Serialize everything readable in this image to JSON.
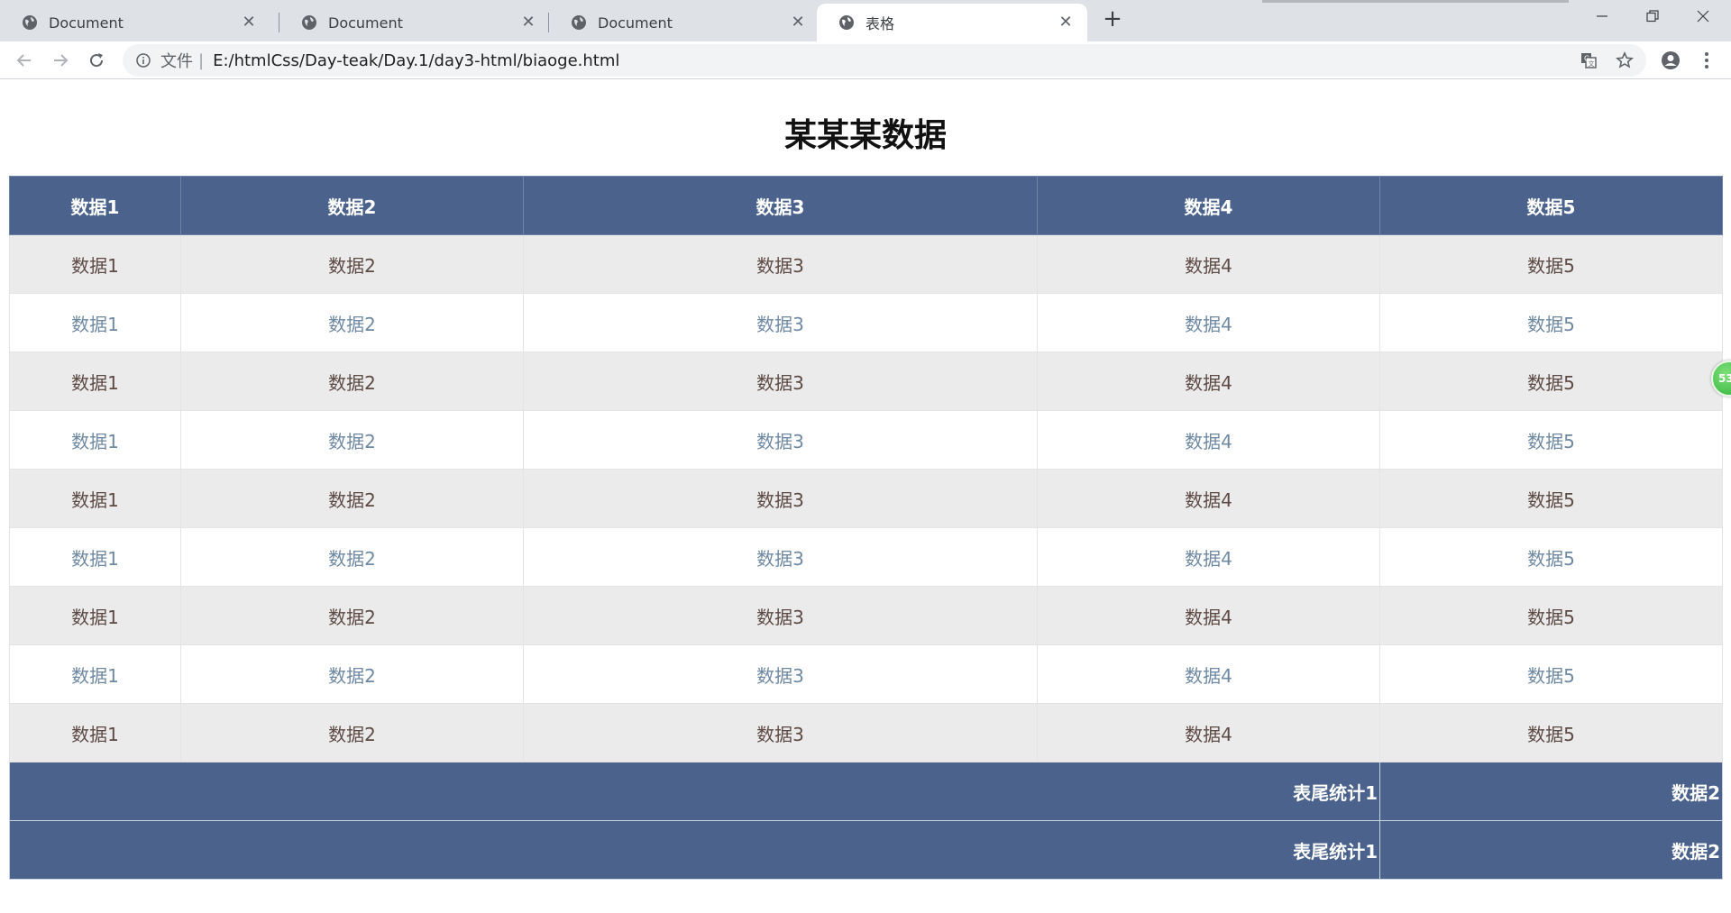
{
  "browser": {
    "tabs": [
      {
        "title": "Document",
        "active": false
      },
      {
        "title": "Document",
        "active": false
      },
      {
        "title": "Document",
        "active": false
      },
      {
        "title": "表格",
        "active": true
      }
    ],
    "new_tab_label": "+",
    "address": {
      "scheme_label": "文件",
      "separator": "|",
      "url": "E:/htmlCss/Day-teak/Day.1/day3-html/biaoge.html"
    }
  },
  "page": {
    "title": "某某某数据",
    "table": {
      "headers": [
        "数据1",
        "数据2",
        "数据3",
        "数据4",
        "数据5"
      ],
      "rows": [
        [
          "数据1",
          "数据2",
          "数据3",
          "数据4",
          "数据5"
        ],
        [
          "数据1",
          "数据2",
          "数据3",
          "数据4",
          "数据5"
        ],
        [
          "数据1",
          "数据2",
          "数据3",
          "数据4",
          "数据5"
        ],
        [
          "数据1",
          "数据2",
          "数据3",
          "数据4",
          "数据5"
        ],
        [
          "数据1",
          "数据2",
          "数据3",
          "数据4",
          "数据5"
        ],
        [
          "数据1",
          "数据2",
          "数据3",
          "数据4",
          "数据5"
        ],
        [
          "数据1",
          "数据2",
          "数据3",
          "数据4",
          "数据5"
        ],
        [
          "数据1",
          "数据2",
          "数据3",
          "数据4",
          "数据5"
        ],
        [
          "数据1",
          "数据2",
          "数据3",
          "数据4",
          "数据5"
        ]
      ],
      "footer": [
        {
          "label": "表尾统计1",
          "value": "数据2"
        },
        {
          "label": "表尾统计1",
          "value": "数据2"
        }
      ]
    }
  },
  "float_widget": {
    "label": "53"
  },
  "colors": {
    "header_bg": "#4a628c",
    "odd_row_bg": "#ebebeb",
    "odd_row_text": "#5d4a44",
    "even_row_text": "#6f89a3",
    "tabstrip_bg": "#dee1e6"
  }
}
